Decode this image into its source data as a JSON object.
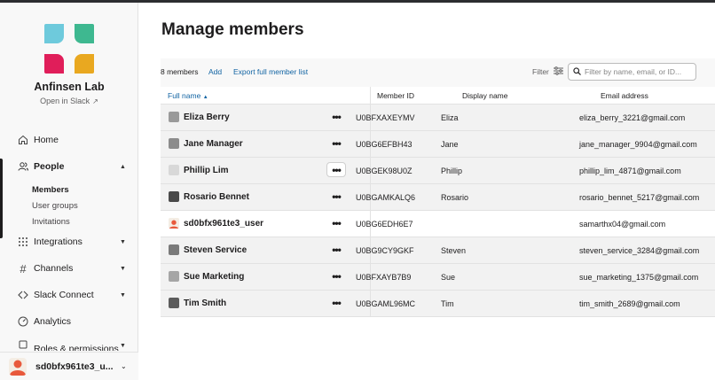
{
  "sidebar": {
    "workspace_name": "Anfinsen Lab",
    "open_in_slack": "Open in Slack",
    "nav": [
      {
        "label": "Home",
        "icon": "home-icon"
      },
      {
        "label": "People",
        "icon": "people-icon",
        "expanded": true
      },
      {
        "label": "Integrations",
        "icon": "grid-icon"
      },
      {
        "label": "Channels",
        "icon": "hash-icon"
      },
      {
        "label": "Slack Connect",
        "icon": "slack-connect-icon"
      },
      {
        "label": "Analytics",
        "icon": "gauge-icon"
      },
      {
        "label": "Roles & permissions",
        "icon": "roles-icon"
      }
    ],
    "people_sub": [
      "Members",
      "User groups",
      "Invitations"
    ],
    "current_user": "sd0bfx961te3_u..."
  },
  "main": {
    "title": "Manage members",
    "member_count": "8 members",
    "add_link": "Add",
    "export_link": "Export full member list",
    "filter_label": "Filter",
    "search_placeholder": "Filter by name, email, or ID...",
    "columns": {
      "full_name": "Full name",
      "member_id": "Member ID",
      "display_name": "Display name",
      "email": "Email address"
    },
    "more_label": "•••",
    "members": [
      {
        "name": "Eliza Berry",
        "id": "U0BFXAXEYMV",
        "display": "Eliza",
        "email": "eliza_berry_3221@gmail.com"
      },
      {
        "name": "Jane Manager",
        "id": "U0BG6EFBH43",
        "display": "Jane",
        "email": "jane_manager_9904@gmail.com"
      },
      {
        "name": "Phillip Lim",
        "id": "U0BGEK98U0Z",
        "display": "Phillip",
        "email": "phillip_lim_4871@gmail.com"
      },
      {
        "name": "Rosario Bennet",
        "id": "U0BGAMKALQ6",
        "display": "Rosario",
        "email": "rosario_bennet_5217@gmail.com"
      },
      {
        "name": "sd0bfx961te3_user",
        "id": "U0BG6EDH6E7",
        "display": "",
        "email": "samarthx04@gmail.com"
      },
      {
        "name": "Steven Service",
        "id": "U0BG9CY9GKF",
        "display": "Steven",
        "email": "steven_service_3284@gmail.com"
      },
      {
        "name": "Sue Marketing",
        "id": "U0BFXAYB7B9",
        "display": "Sue",
        "email": "sue_marketing_1375@gmail.com"
      },
      {
        "name": "Tim Smith",
        "id": "U0BGAML96MC",
        "display": "Tim",
        "email": "tim_smith_2689@gmail.com"
      }
    ]
  },
  "colors": {
    "accent_link": "#1264a3",
    "logo_blue": "#6ecadc",
    "logo_green": "#3eb890",
    "logo_red": "#e01e5a",
    "logo_yellow": "#e9a820"
  }
}
